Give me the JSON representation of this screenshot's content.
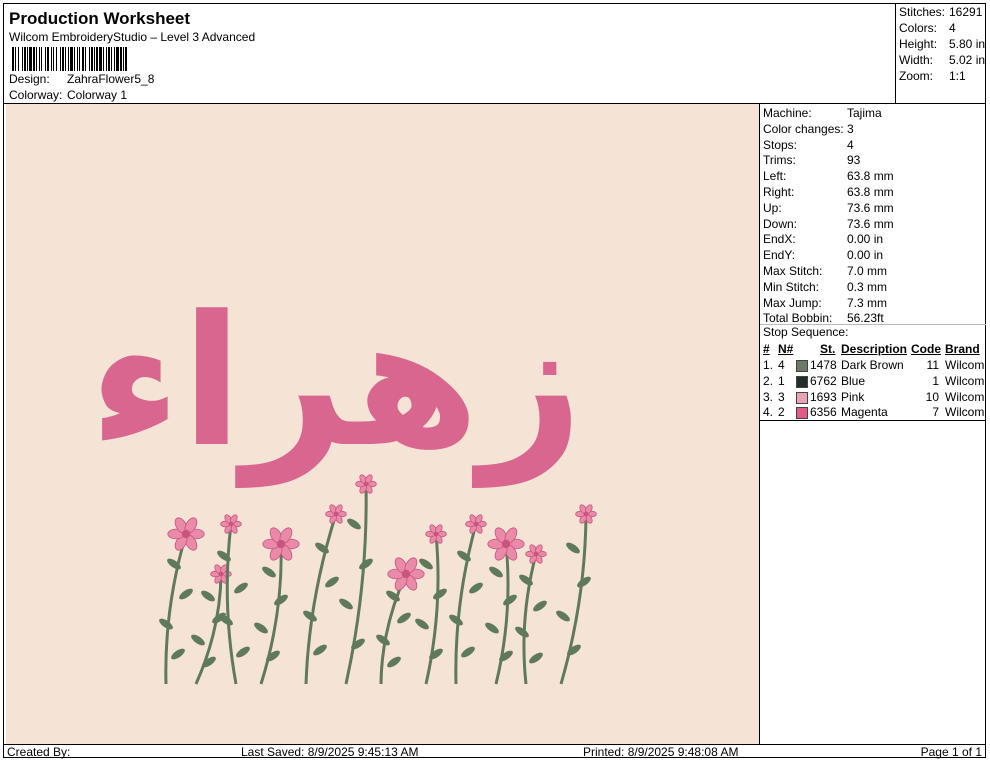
{
  "header": {
    "title": "Production Worksheet",
    "subtitle": "Wilcom EmbroideryStudio – Level 3 Advanced",
    "design_label": "Design:",
    "design_value": "ZahraFlower5_8",
    "colorway_label": "Colorway:",
    "colorway_value": "Colorway 1"
  },
  "stats": [
    {
      "label": "Stitches:",
      "value": "16291"
    },
    {
      "label": "Colors:",
      "value": "4"
    },
    {
      "label": "Height:",
      "value": "5.80 in"
    },
    {
      "label": "Width:",
      "value": "5.02 in"
    },
    {
      "label": "Zoom:",
      "value": "1:1"
    }
  ],
  "machine_info": [
    {
      "label": "Machine:",
      "value": "Tajima"
    },
    {
      "label": "Color changes:",
      "value": "3"
    },
    {
      "label": "Stops:",
      "value": "4"
    },
    {
      "label": "Trims:",
      "value": "93"
    },
    {
      "label": "Left:",
      "value": "63.8 mm"
    },
    {
      "label": "Right:",
      "value": "63.8 mm"
    },
    {
      "label": "Up:",
      "value": "73.6 mm"
    },
    {
      "label": "Down:",
      "value": "73.6 mm"
    },
    {
      "label": "EndX:",
      "value": "0.00 in"
    },
    {
      "label": "EndY:",
      "value": "0.00 in"
    },
    {
      "label": "Max Stitch:",
      "value": "7.0 mm"
    },
    {
      "label": "Min Stitch:",
      "value": "0.3 mm"
    },
    {
      "label": "Max Jump:",
      "value": "7.3 mm"
    },
    {
      "label": "Total Bobbin:",
      "value": "56.23ft"
    }
  ],
  "stop_sequence": {
    "title": "Stop Sequence:",
    "columns": [
      "#",
      "N#",
      "St.",
      "Description",
      "Code",
      "Brand"
    ],
    "rows": [
      {
        "num": "1.",
        "n": "4",
        "color": "#6b7a62",
        "st": "1478",
        "desc": "Dark Brown",
        "code": "11",
        "brand": "Wilcom"
      },
      {
        "num": "2.",
        "n": "1",
        "color": "#1f2e26",
        "st": "6762",
        "desc": "Blue",
        "code": "1",
        "brand": "Wilcom"
      },
      {
        "num": "3.",
        "n": "3",
        "color": "#eda1b4",
        "st": "1693",
        "desc": "Pink",
        "code": "10",
        "brand": "Wilcom"
      },
      {
        "num": "4.",
        "n": "2",
        "color": "#e25a8a",
        "st": "6356",
        "desc": "Magenta",
        "code": "7",
        "brand": "Wilcom"
      }
    ]
  },
  "design": {
    "text": "زهراء",
    "text_color": "#d9668f",
    "leaf_color": "#5f7a5a",
    "flower_color": "#e98aa8",
    "background_color": "#f5e3d6"
  },
  "footer": {
    "created_by": "Created By:",
    "last_saved": "Last Saved: 8/9/2025 9:45:13 AM",
    "printed": "Printed: 8/9/2025 9:48:08 AM",
    "page": "Page 1 of 1"
  }
}
